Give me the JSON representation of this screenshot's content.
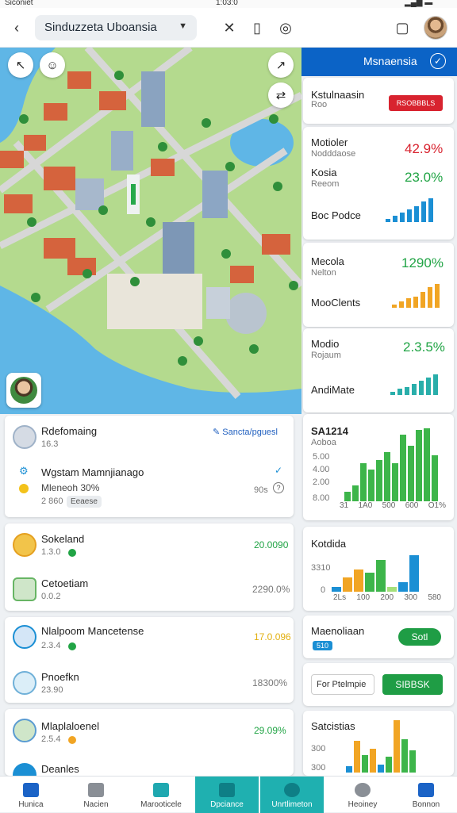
{
  "status": {
    "left": "Siconiet",
    "center": "1:03:0"
  },
  "topbar": {
    "search_value": "Sinduzzeta Uboansia"
  },
  "panel": {
    "title": "Msnaensia"
  },
  "right": {
    "card1": {
      "title": "Kstulnaasin",
      "sub": "Roo",
      "badge": "RSOBBBLS"
    },
    "card2": {
      "l1": "Motioler",
      "s1": "Nodddaose",
      "p1": "42.9%",
      "l2": "Kosia",
      "s2": "Reeom",
      "p2": "23.0%",
      "l3": "Boc Podce"
    },
    "card3": {
      "l1": "Mecola",
      "s1": "Nelton",
      "p1": "1290%",
      "l2": "MooClents"
    },
    "card4": {
      "l1": "Modio",
      "s1": "Rojaum",
      "p1": "2.3.5%",
      "l2": "AndiMate"
    },
    "chart1": {
      "title": "SA1214",
      "sub": "Aoboa",
      "yticks": [
        "5.00",
        "4.00",
        "2.00",
        "8.00"
      ],
      "xticks": [
        "31",
        "1A0",
        "500",
        "600",
        "O1%"
      ]
    },
    "chart2": {
      "title": "Kotdida",
      "yticks": [
        "3310",
        "0"
      ],
      "xticks": [
        "2Ls",
        "100",
        "200",
        "300",
        "580"
      ]
    },
    "card5": {
      "title": "Maenoliaan",
      "badge": "510",
      "btn": "Sotl"
    },
    "card6": {
      "input": "For Ptelmpie",
      "btn": "SIBBSK"
    },
    "chart3": {
      "title": "Satcistias",
      "yticks": [
        "300",
        "300"
      ]
    }
  },
  "left": {
    "card1": {
      "r1": {
        "title": "Rdefomaing",
        "sub": "16.3",
        "link": "Sancta/pguesl"
      },
      "r2": {
        "title": "Wgstam Mamnjianago",
        "sub": "Mleneoh 30%",
        "meta": "2 860",
        "pill": "Eeaese",
        "val": "90s"
      }
    },
    "card2": {
      "r1": {
        "title": "Sokeland",
        "sub": "1.3.0",
        "val": "20.0090"
      },
      "r2": {
        "title": "Cetoetiam",
        "sub": "0.0.2",
        "val": "2290.0%"
      }
    },
    "card3": {
      "r1": {
        "title": "Nlalpoom Mancetense",
        "sub": "2.3.4",
        "val": "17.0.096"
      },
      "r2": {
        "title": "Pnoefkn",
        "sub": "23.90",
        "val": "18300%"
      }
    },
    "card4": {
      "r1": {
        "title": "Mlaplaloenel",
        "sub": "2.5.4",
        "val": "29.09%"
      },
      "r2": {
        "title": "Deanles"
      }
    }
  },
  "nav": [
    "Hunica",
    "Nacien",
    "Marooticele",
    "Dpciance",
    "Unrtlimeton",
    "Heoiney",
    "Bonnon"
  ]
}
